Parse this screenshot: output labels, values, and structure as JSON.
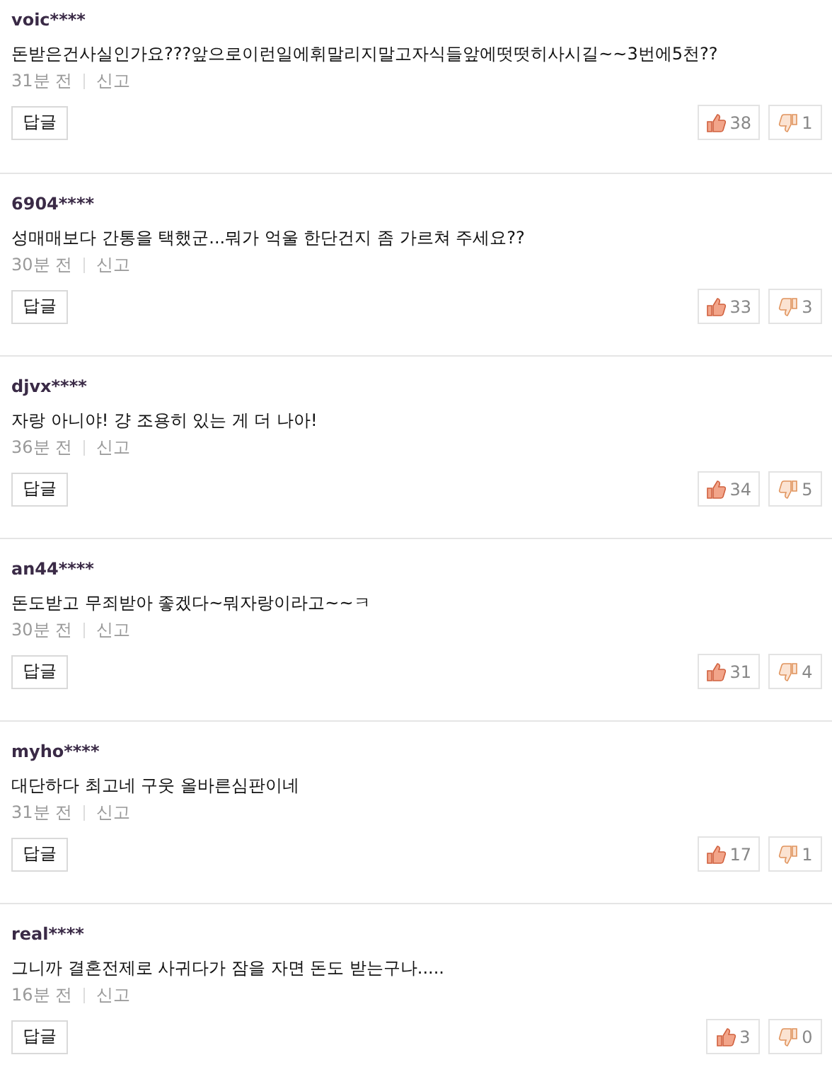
{
  "comments": [
    {
      "author": "voic****",
      "text": "돈받은건사실인가요???앞으로이런일에휘말리지말고자식들앞에떳떳히사시길~~3번에5천??",
      "time": "31분 전",
      "report": "신고",
      "reply": "답글",
      "likes": "38",
      "dislikes": "1"
    },
    {
      "author": "6904****",
      "text": "성매매보다 간통을 택했군...뭐가 억울 한단건지 좀 가르쳐 주세요??",
      "time": "30분 전",
      "report": "신고",
      "reply": "답글",
      "likes": "33",
      "dislikes": "3"
    },
    {
      "author": "djvx****",
      "text": "자랑 아니야! 걍 조용히 있는 게 더 나아!",
      "time": "36분 전",
      "report": "신고",
      "reply": "답글",
      "likes": "34",
      "dislikes": "5"
    },
    {
      "author": "an44****",
      "text": "돈도받고 무죄받아 좋겠다~뭐자랑이라고~~ㅋ",
      "time": "30분 전",
      "report": "신고",
      "reply": "답글",
      "likes": "31",
      "dislikes": "4"
    },
    {
      "author": "myho****",
      "text": "대단하다 최고네 구웃 올바른심판이네",
      "time": "31분 전",
      "report": "신고",
      "reply": "답글",
      "likes": "17",
      "dislikes": "1"
    },
    {
      "author": "real****",
      "text": "그니까 결혼전제로 사귀다가 잠을 자면 돈도 받는구나.....",
      "time": "16분 전",
      "report": "신고",
      "reply": "답글",
      "likes": "3",
      "dislikes": "0"
    }
  ]
}
